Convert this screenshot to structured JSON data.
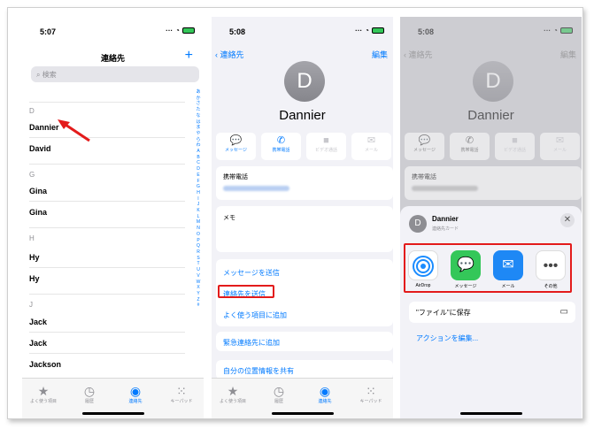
{
  "status": {
    "time": "5:07",
    "time2": "5:08",
    "time3": "5:08"
  },
  "contacts_list": {
    "title": "連絡先",
    "add_icon": "+",
    "search_placeholder": "検索",
    "sections": [
      {
        "letter": "D",
        "names": [
          "Dannier",
          "David"
        ]
      },
      {
        "letter": "G",
        "names": [
          "Gina",
          "Gina"
        ]
      },
      {
        "letter": "H",
        "names": [
          "Hy",
          "Hy"
        ]
      },
      {
        "letter": "J",
        "names": [
          "Jack",
          "Jack",
          "Jackson"
        ]
      }
    ],
    "index": [
      "あ",
      "か",
      "さ",
      "た",
      "な",
      "は",
      "ま",
      "や",
      "ら",
      "わ",
      "A",
      "B",
      "C",
      "D",
      "E",
      "F",
      "G",
      "H",
      "I",
      "J",
      "K",
      "L",
      "M",
      "N",
      "O",
      "P",
      "Q",
      "R",
      "S",
      "T",
      "U",
      "V",
      "W",
      "X",
      "Y",
      "Z",
      "#"
    ]
  },
  "tabbar": {
    "favorites": "よく使う項目",
    "recents": "履歴",
    "contacts": "連絡先",
    "keypad": "キーパッド"
  },
  "contact_detail": {
    "back": "連絡先",
    "edit": "編集",
    "avatar_initial": "D",
    "name": "Dannier",
    "actions": [
      "メッセージ",
      "携帯電話",
      "ビデオ通話",
      "メール"
    ],
    "phone_label": "携帯電話",
    "memo_label": "メモ",
    "links": [
      "メッセージを送信",
      "連絡先を送信",
      "よく使う項目に追加"
    ],
    "emergency": "緊急連絡先に追加",
    "share_location": "自分の位置情報を共有"
  },
  "share_sheet": {
    "name": "Dannier",
    "subtitle": "連絡先カード",
    "close": "✕",
    "apps": [
      "AirDrop",
      "メッセージ",
      "メール",
      "その他"
    ],
    "save_to_files": "\"ファイル\"に保存",
    "edit_actions": "アクションを編集...",
    "colors": {
      "messages": "#34c759",
      "mail": "#1e88f5",
      "airdrop": "#1a8cff",
      "highlight": "#e31b1b"
    }
  }
}
